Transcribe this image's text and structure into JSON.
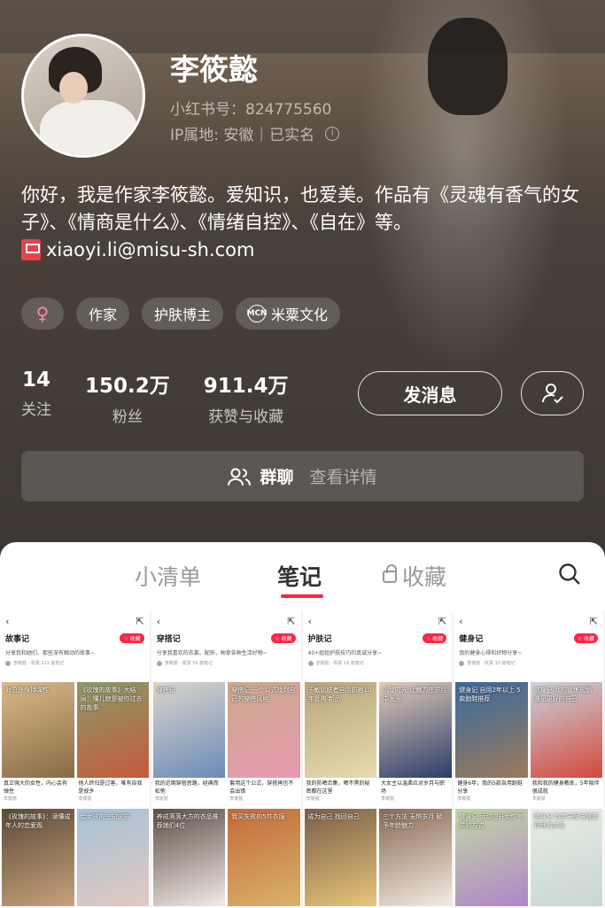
{
  "profile": {
    "name": "李筱懿",
    "red_id": "小红书号：824775560",
    "ip": "IP属地: 安徽",
    "verified": "已实名",
    "bio": "你好，我是作家李筱懿。爱知识，也爱美。作品有《灵魂有香气的女子》、《情商是什么》、《情绪自控》、《自在》等。",
    "email": "xiaoyi.li@misu-sh.com",
    "tags": [
      "作家",
      "护肤博主",
      "米粟文化"
    ],
    "gender_symbol": "♀",
    "mcn_label": "MCN"
  },
  "stats": [
    {
      "num": "14",
      "label": "关注"
    },
    {
      "num": "150.2万",
      "label": "粉丝"
    },
    {
      "num": "911.4万",
      "label": "获赞与收藏"
    }
  ],
  "actions": {
    "message": "发消息"
  },
  "group": {
    "label": "群聊",
    "detail": "查看详情"
  },
  "tabs": [
    "小清单",
    "笔记",
    "收藏"
  ],
  "albums": [
    {
      "title": "故事记",
      "collect": "收藏",
      "desc": "分享我和她们、那些深有触动的故事~",
      "author": "李筱懿 · 收录 122 篇笔记",
      "cards": [
        {
          "img_text": "对总外保持弹性",
          "cap": "真正强大的女性，内心会有弹性",
          "color1": "#d9b98a",
          "color2": "#8a6a44"
        },
        {
          "img_text": "《玫瑰的故事》大结局：懂儿娘是被你过去的故事",
          "cap": "他人终归是过客，唯有自我是故乡",
          "color1": "#8a9a6a",
          "color2": "#c65a3a"
        },
        {
          "img_text": "《玫瑰的故事》：读懂成年人的恋爱观",
          "cap": "",
          "color1": "#5a4a3a",
          "color2": "#c9a27a"
        },
        {
          "img_text": "给女孩的三句忠告",
          "cap": "",
          "color1": "#a4c2d6",
          "color2": "#e2c9c0"
        }
      ]
    },
    {
      "title": "穿搭记",
      "collect": "收藏",
      "desc": "分享我喜欢的衣裳、配饰，种草各种生活好物~",
      "author": "李筱懿 · 收录 56 篇笔记",
      "cards": [
        {
          "img_text": "穿搭记",
          "cap": "我的近期穿搭思路，经典而松弛",
          "color1": "#dad4cc",
          "color2": "#6a8cb8"
        },
        {
          "img_text": "穿搭记 一个公式找到自己的穿搭风格",
          "cap": "套用这个公式，穿搭再也不会出错",
          "color1": "#c9a98a",
          "color2": "#e89ab2"
        },
        {
          "img_text": "养成落落大方的衣品推荐她们4位",
          "cap": "",
          "color1": "#5e4e46",
          "color2": "#f1ece6"
        },
        {
          "img_text": "我买失败的5件衣服",
          "cap": "",
          "color1": "#c46a3a",
          "color2": "#d9b26a"
        }
      ]
    },
    {
      "title": "护肤记",
      "collect": "收藏",
      "desc": "40+姐姐护肤技巧的真诚分享~",
      "author": "李筱懿 · 收录 18 篇笔记",
      "cards": [
        {
          "img_text": "干敏肌肤者自用防晒10年复购·新品",
          "cap": "我的防晒合集，晒不黑的秘密都在这里",
          "color1": "#b8a57a",
          "color2": "#e6dcae"
        },
        {
          "img_text": "沉淀时光 让魅力在岁月中发光",
          "cap": "大女主以温柔应对岁月与职场",
          "color1": "#e1cbb8",
          "color2": "#2a3d6a"
        },
        {
          "img_text": "成为自己 找回自己",
          "cap": "",
          "color1": "#7a5e48",
          "color2": "#e8c67a"
        },
        {
          "img_text": "三个方法 无惧岁月 赋予年龄魅力",
          "cap": "",
          "color1": "#8a6a54",
          "color2": "#f3ece4"
        }
      ]
    },
    {
      "title": "健身记",
      "collect": "收藏",
      "desc": "我的健身心得和好物分享~",
      "author": "李筱懿 · 收录 33 篇笔记",
      "cards": [
        {
          "img_text": "健身记 自用2年以上 5款跑鞋推荐",
          "cap": "健身6年，我的5款自用跑鞋分享",
          "color1": "#3a6aa0",
          "color2": "#9a7a5a"
        },
        {
          "img_text": "健身记 我的锻炼规划 遇见更好的自己",
          "cap": "我和我的健身教练，5年陪伴很成就",
          "color1": "#c9d4dc",
          "color2": "#d4473c"
        },
        {
          "img_text": "健身记 运动提升女性气质的方式",
          "cap": "",
          "color1": "#c2d6a4",
          "color2": "#b086c8"
        },
        {
          "img_text": "健身记 数学天赋与健康管理的关系",
          "cap": "",
          "color1": "#e6ece4",
          "color2": "#c9d6d2"
        }
      ]
    }
  ]
}
